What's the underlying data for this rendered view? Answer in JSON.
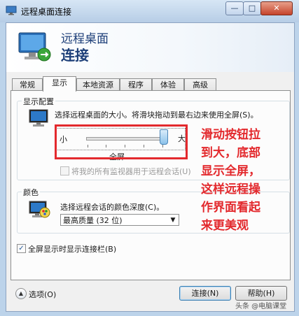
{
  "window": {
    "title": "远程桌面连接",
    "min_glyph": "—",
    "max_glyph": "□",
    "close_glyph": "✕"
  },
  "header": {
    "line1": "远程桌面",
    "line2": "连接"
  },
  "tabs": [
    {
      "label": "常规",
      "active": false
    },
    {
      "label": "显示",
      "active": true
    },
    {
      "label": "本地资源",
      "active": false
    },
    {
      "label": "程序",
      "active": false
    },
    {
      "label": "体验",
      "active": false
    },
    {
      "label": "高级",
      "active": false
    }
  ],
  "display_config": {
    "legend": "显示配置",
    "description": "选择远程桌面的大小。将滑块拖动到最右边来使用全屏(S)。",
    "slider_min_label": "小",
    "slider_max_label": "大",
    "slider_value_text": "全屏",
    "slider_level": 1.0,
    "use_all_monitors_label": "将我的所有监视器用于远程会话(U)",
    "use_all_monitors_checked": false
  },
  "colors": {
    "legend": "颜色",
    "description": "选择远程会话的颜色深度(C)。",
    "selected_depth": "最高质量 (32 位)"
  },
  "connection_bar": {
    "label": "全屏显示时显示连接栏(B)",
    "checked": true,
    "check_glyph": "✓"
  },
  "annotation": {
    "lines": [
      "滑动按钮拉",
      "到大，底部",
      "显示全屏，",
      "这样远程操",
      "作界面看起",
      "来更美观"
    ],
    "color": "#e3292d"
  },
  "footer": {
    "options_label": "选项(O)",
    "options_glyph": "▲",
    "connect_label": "连接(N)",
    "help_label": "帮助(H)"
  },
  "watermark": "头条 @电脑课堂"
}
